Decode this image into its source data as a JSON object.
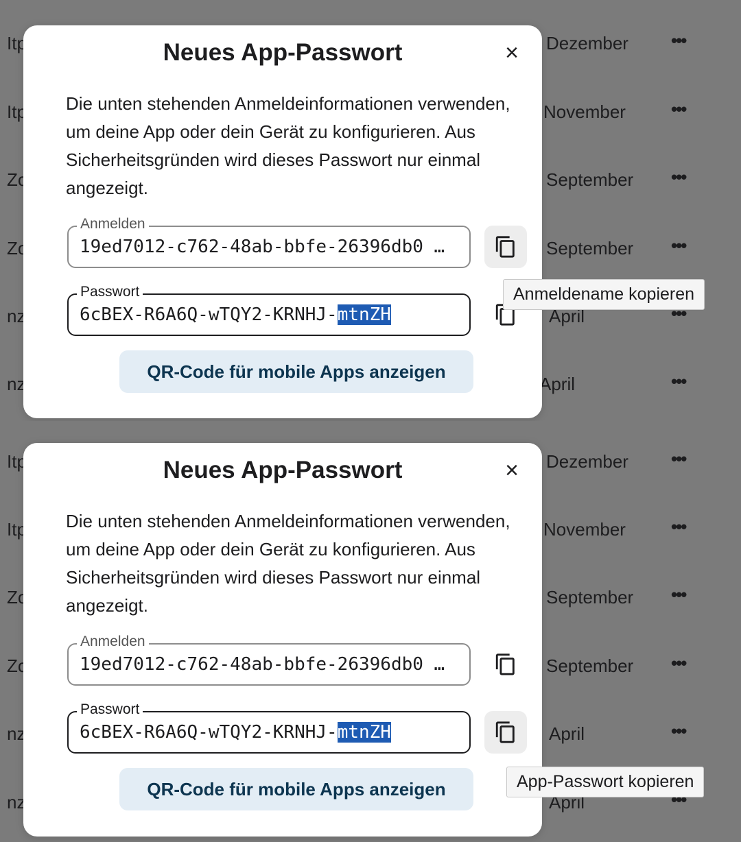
{
  "background_rows": [
    {
      "name": "Itp",
      "month": "Dezember",
      "more": "•••"
    },
    {
      "name": "Itp",
      "month": "November",
      "more": "•••"
    },
    {
      "name": "Zo",
      "month": "September",
      "more": "•••"
    },
    {
      "name": "Zo",
      "month": "September",
      "more": "•••"
    },
    {
      "name": "nz",
      "month": "April",
      "more": "•••"
    },
    {
      "name": "nz",
      "month": "April",
      "more": "•••"
    }
  ],
  "dialog": {
    "title": "Neues App-Passwort",
    "close_icon": "×",
    "description": "Die unten stehenden Anmeldeinformationen verwenden, um deine App oder dein Gerät zu konfigurieren. Aus Sicherheitsgründen wird dieses Passwort nur einmal angezeigt.",
    "login_label": "Anmelden",
    "login_value": "19ed7012-c762-48ab-bbfe-26396db0 …",
    "password_label": "Passwort",
    "password_prefix": "6cBEX-R6A6Q-wTQY2-KRNHJ-",
    "password_selected": "mtnZH",
    "qr_button": "QR-Code für mobile Apps anzeigen"
  },
  "tooltips": {
    "copy_login": "Anmeldename kopieren",
    "copy_password": "App-Passwort kopieren"
  },
  "colors": {
    "overlay": "#7b7b7b",
    "selection": "#1e5bb3",
    "qr_button_bg": "#e3edf5",
    "qr_button_text": "#0d3550"
  }
}
